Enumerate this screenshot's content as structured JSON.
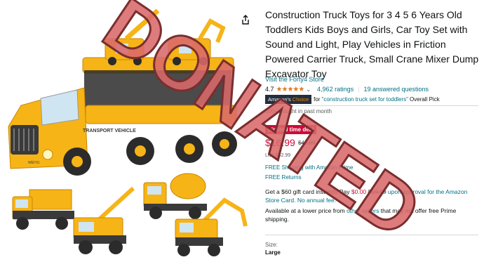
{
  "product": {
    "title": "Construction Truck Toys for 3 4 5 6 Years Old Toddlers Kids Boys and Girls, Car Toy Set with Sound and Light, Play Vehicles in Friction Powered Carrier Truck, Small Crane Mixer Dump Excavator Toy",
    "store_link": "Visit the Forty4 Store",
    "rating_value": "4.7",
    "stars": "★★★★★",
    "ratings_count": "4,962 ratings",
    "answered_questions": "19 answered questions",
    "badge_prefix": "Amazon's",
    "badge_word": "Choice",
    "choice_for": "for",
    "choice_query": "\"construction truck set for toddlers\"",
    "choice_suffix": "Overall Pick",
    "bought": "500+ bought in past month",
    "deal_label": "Limited time deal",
    "price": "$16.99",
    "list_price_strike": "$42.99",
    "list_label": "List: $42.99",
    "shipping_line": "FREE Shipping with Amazon Prime",
    "returns_line": "FREE Returns",
    "gift_text_1": "Get a $60 gift card instantly",
    "gift_text_2": "Pay",
    "gift_price": "$0.00",
    "gift_old_price": "$19.99",
    "gift_text_3": "upon approval for the Amazon Store Card. No annual fee.",
    "avail_text_1": "Available at a lower price from",
    "avail_link": "other sellers",
    "avail_text_2": "that may not offer free Prime shipping.",
    "size_label": "Size:",
    "size_value": "Large"
  },
  "image": {
    "truck_label": "TRANSPORT VEHICLE",
    "plate_label": "WEIYU"
  },
  "stamp": {
    "text": "DONATED",
    "color": "#d9696a"
  },
  "colors": {
    "link": "#007185",
    "price_red": "#cc0c39",
    "star": "#de7921",
    "toy_yellow": "#f6b417",
    "toy_dark": "#2b2b2b"
  }
}
